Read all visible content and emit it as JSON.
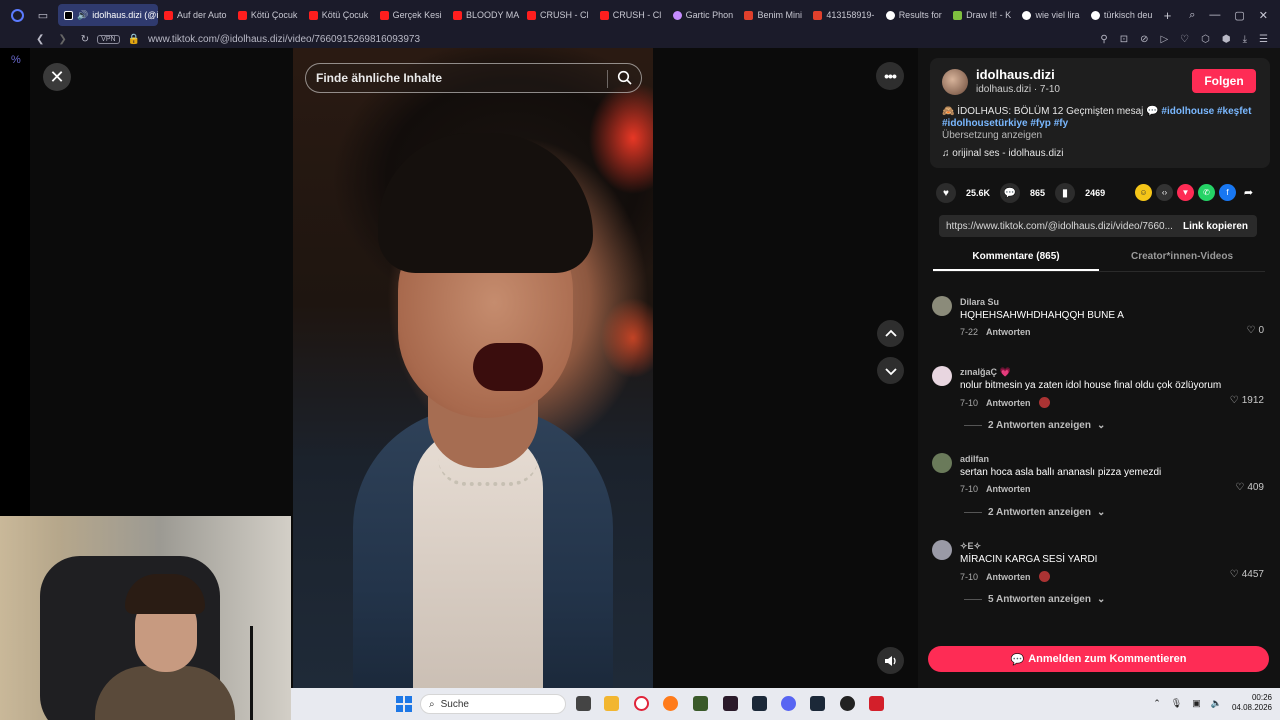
{
  "browser": {
    "tabs": [
      {
        "label": "idolhaus.dizi (@id",
        "active": true,
        "icon": "tiktok"
      },
      {
        "label": "Auf der Auto",
        "icon": "youtube"
      },
      {
        "label": "Kötü Çocuk",
        "icon": "youtube"
      },
      {
        "label": "Kötü Çocuk",
        "icon": "youtube"
      },
      {
        "label": "Gerçek Kesi",
        "icon": "youtube"
      },
      {
        "label": "BLOODY MA",
        "icon": "youtube"
      },
      {
        "label": "CRUSH - Cl",
        "icon": "youtube"
      },
      {
        "label": "CRUSH - Cl",
        "icon": "youtube"
      },
      {
        "label": "Gartic Phon",
        "icon": "gartic"
      },
      {
        "label": "Benim Mini",
        "icon": "red"
      },
      {
        "label": "413158919-",
        "icon": "red"
      },
      {
        "label": "Results for",
        "icon": "google"
      },
      {
        "label": "Draw It! - K",
        "icon": "draw"
      },
      {
        "label": "wie viel lira",
        "icon": "google"
      },
      {
        "label": "türkisch deu",
        "icon": "google"
      }
    ],
    "new_tab": "+",
    "vpn_label": "VPN",
    "url": "www.tiktok.com/@idolhaus.dizi/video/7660915269816093973",
    "sidebar_symbol": "%"
  },
  "video": {
    "search_placeholder": "Finde ähnliche Inhalte",
    "close_symbol": "✕",
    "more_symbol": "•••"
  },
  "post": {
    "author_name": "idolhaus.dizi",
    "author_sub": "idolhaus.dizi · 7-10",
    "follow_label": "Folgen",
    "description_plain": "🙈 İDOLHAUS: BÖLÜM 12 Geçmişten mesaj 💬 ",
    "hashtags_line1": "#idolhouse #keşfet",
    "hashtags_line2": "#idolhousetürkiye #fyp #fy",
    "translate_label": "Übersetzung anzeigen",
    "music_label": "orijinal ses - idolhaus.dizi",
    "likes": "25.6K",
    "comments_count": "865",
    "saves": "2469",
    "link_url": "https://www.tiktok.com/@idolhaus.dizi/video/7660...",
    "copy_link_label": "Link kopieren"
  },
  "tabs": {
    "comments_label": "Kommentare (865)",
    "creator_videos_label": "Creator*innen-Videos"
  },
  "comments": [
    {
      "user": "Dilara Su",
      "text": "HQHEHSAHWHDHAHQQH BUNE A",
      "date": "7-22",
      "reply": "Antworten",
      "likes": "0",
      "more": "",
      "avatar_color": "#8b8b7a"
    },
    {
      "user": "zınalğaÇ 💗",
      "text": "nolur bitmesin ya zaten idol house final oldu çok özlüyorum",
      "date": "7-10",
      "reply": "Antworten",
      "likes": "1912",
      "more": "2 Antworten anzeigen",
      "avatar_color": "#e8d6e0"
    },
    {
      "user": "adilfan",
      "text": "sertan hoca asla ballı ananaslı pizza yemezdi",
      "date": "7-10",
      "reply": "Antworten",
      "likes": "409",
      "more": "2 Antworten anzeigen",
      "avatar_color": "#6a7a5a"
    },
    {
      "user": "✧E✧",
      "text": "MİRACIN KARGA SESİ YARDI",
      "date": "7-10",
      "reply": "Antworten",
      "likes": "4457",
      "more": "5 Antworten anzeigen",
      "avatar_color": "#9a9aa6"
    }
  ],
  "login_button": "Anmelden zum Kommentieren",
  "taskbar": {
    "search_label": "Suche",
    "time": "00:26",
    "date": "04.08.2026"
  },
  "colors": {
    "accent": "#fe2c55",
    "hashtag": "#7ab8ff",
    "panel_bg": "#121212"
  }
}
